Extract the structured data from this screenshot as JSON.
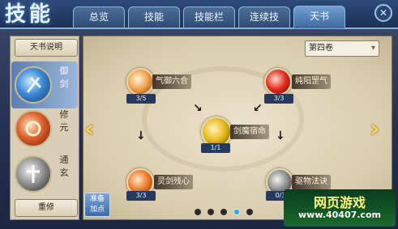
{
  "header": {
    "logo": "技能",
    "tabs": [
      {
        "label": "总览",
        "active": false
      },
      {
        "label": "技能",
        "active": false
      },
      {
        "label": "技能栏",
        "active": false
      },
      {
        "label": "连续技",
        "active": false
      },
      {
        "label": "天书",
        "active": true
      }
    ],
    "close_icon": "close-icon"
  },
  "sidebar": {
    "title": "天书说明",
    "items": [
      {
        "label": "御剑",
        "active": true
      },
      {
        "label": "修元",
        "active": false
      },
      {
        "label": "通玄",
        "active": false
      }
    ],
    "reset": "重修"
  },
  "main": {
    "volume": "第四卷",
    "nodes": [
      {
        "name": "气御六合",
        "count": "3/5"
      },
      {
        "name": "纯阳罡气",
        "count": "3/3"
      },
      {
        "name": "剑魔宿命",
        "count": "1/1"
      },
      {
        "name": "灵剑残心",
        "count": "3/3"
      },
      {
        "name": "驱物法诀",
        "count": "0/3"
      }
    ],
    "mix_button": "准备加点",
    "page_dots": 5,
    "active_dot": 4
  },
  "watermark": {
    "title": "网页游戏",
    "url": "www.40407.com"
  },
  "colors": {
    "accent": "#ffd24a",
    "frame": "#7fb2e0",
    "parchment": "#e3d8bd"
  }
}
